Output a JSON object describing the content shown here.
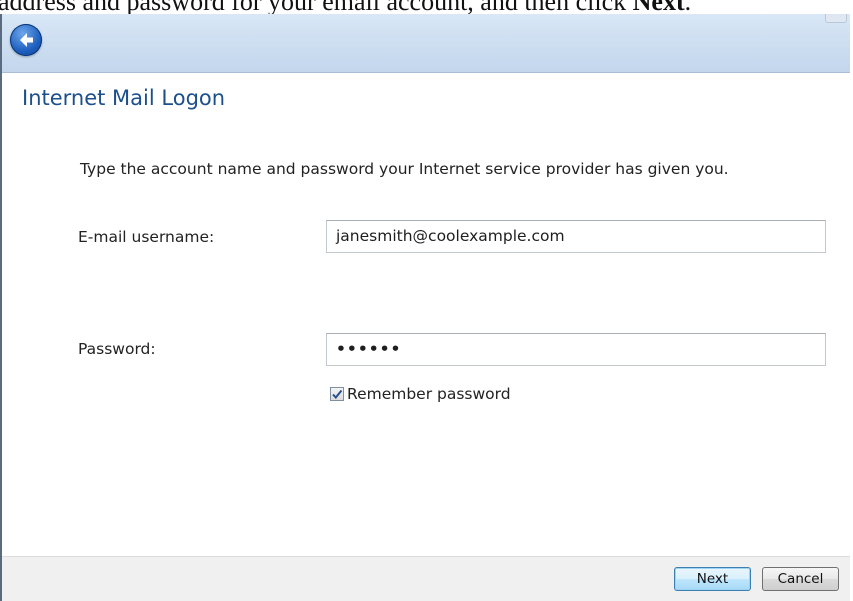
{
  "caption": {
    "text_before": "address and password for your email account, and then click ",
    "text_bold": "Next",
    "text_after": "."
  },
  "nav": {
    "back_icon": "back-arrow-icon"
  },
  "dialog": {
    "title": "Internet Mail Logon",
    "instruction": "Type the account name and password your Internet service provider has given you."
  },
  "form": {
    "username_label": "E-mail username:",
    "username_value": "janesmith@coolexample.com",
    "password_label": "Password:",
    "password_value": "••••••",
    "remember_label": "Remember password",
    "remember_checked": true
  },
  "buttons": {
    "next_label": "Next",
    "cancel_label": "Cancel"
  },
  "colors": {
    "title": "#1c4f8c",
    "nav_bar": "#c9dbef",
    "footer": "#f0f0f0"
  }
}
